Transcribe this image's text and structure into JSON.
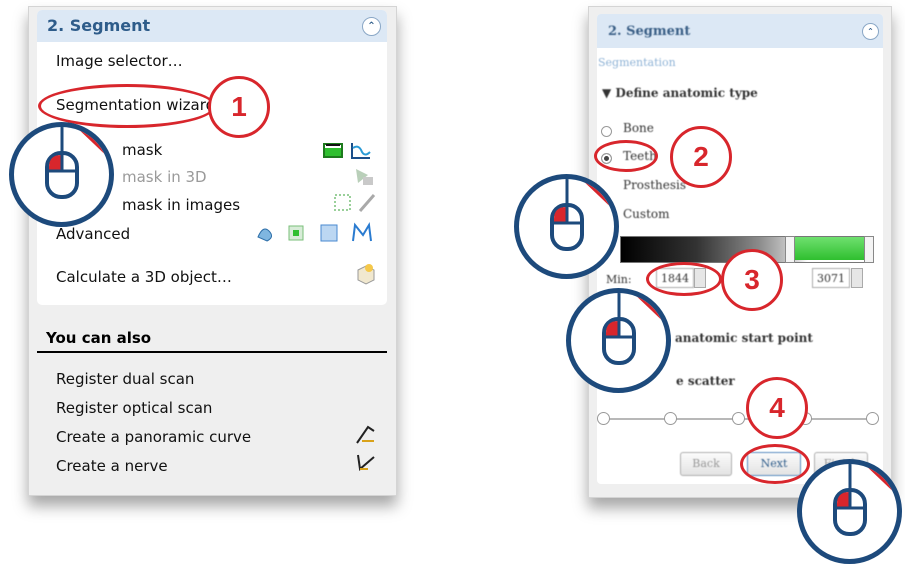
{
  "left": {
    "header_title": "2. Segment",
    "items": [
      {
        "label": "Image selector…"
      },
      {
        "label": "Segmentation wizard"
      },
      {
        "label": "mask"
      },
      {
        "label": "mask in 3D"
      },
      {
        "label": "mask in images"
      },
      {
        "label": "Advanced"
      },
      {
        "label": "Calculate a 3D object…"
      }
    ],
    "also_title": "You can also",
    "also_items": [
      {
        "label": "Register dual scan"
      },
      {
        "label": "Register optical scan"
      },
      {
        "label": "Create a panoramic curve"
      },
      {
        "label": "Create a nerve"
      }
    ]
  },
  "right": {
    "header_title": "2. Segment",
    "subheading": "Segmentation",
    "section": "Define anatomic type",
    "radio_options": [
      {
        "label": "Bone",
        "selected": false
      },
      {
        "label": "Teeth",
        "selected": true
      },
      {
        "label": "Prosthesis",
        "selected": false
      },
      {
        "label": "Custom",
        "selected": false
      }
    ],
    "min_label": "Min:",
    "min_value": "1844",
    "max_value": "3071",
    "start_point_label": "anatomic start point",
    "scatter_label": "e scatter",
    "buttons": {
      "back": "Back",
      "next": "Next",
      "finish": "Finish"
    }
  },
  "annotations": {
    "step1": "1",
    "step2": "2",
    "step3": "3",
    "step4": "4"
  },
  "colors": {
    "accent_red": "#d8262c",
    "mouse_blue": "#1d4a7c",
    "header_text": "#2e5c8a",
    "header_bg": "#dce8f5"
  }
}
